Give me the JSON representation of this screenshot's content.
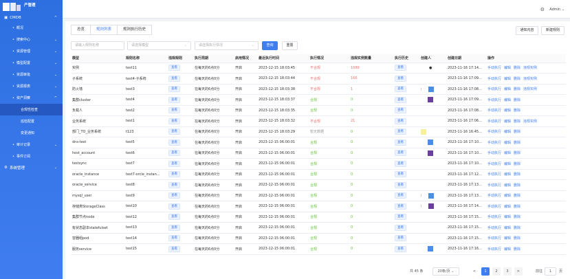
{
  "app": {
    "logo_text": "产管理"
  },
  "topbar": {
    "gear_icon": "gear-icon",
    "user": "Admin",
    "user_chevron": "⌄"
  },
  "sidebar": {
    "group": {
      "label": "CMDB",
      "icon": "grid-icon",
      "chevron": "^"
    },
    "items": [
      {
        "label": "概况",
        "has_children": false
      },
      {
        "label": "搜索中心",
        "has_children": true
      },
      {
        "label": "资源管理",
        "has_children": true
      },
      {
        "label": "模型配置",
        "has_children": true
      },
      {
        "label": "资源审批",
        "has_children": true
      },
      {
        "label": "资源报表",
        "has_children": true
      },
      {
        "label": "资产洞察",
        "has_children": true,
        "expanded": true
      }
    ],
    "sub_items": [
      {
        "label": "合规性检查",
        "active": true
      },
      {
        "label": "巡检配置",
        "active": false
      },
      {
        "label": "变更通知",
        "active": false
      }
    ],
    "items_after": [
      {
        "label": "审计记录",
        "has_children": true
      },
      {
        "label": "事件订阅",
        "has_children": false
      }
    ],
    "system": {
      "label": "系统管理",
      "icon": "settings-icon",
      "chevron": "⌄"
    }
  },
  "tabs": [
    {
      "label": "总览",
      "active": false
    },
    {
      "label": "规则列表",
      "active": true
    },
    {
      "label": "规则执行历史",
      "active": false
    }
  ],
  "toolbar": {
    "notify_label": "通知内容",
    "new_rule_label": "新建规则"
  },
  "filters": {
    "rule_name_placeholder": "请输入规则名称",
    "model_placeholder": "请选择模型",
    "exec_status_placeholder": "请选择执行情况",
    "search_label": "查询",
    "reset_label": "重置"
  },
  "table": {
    "headers": [
      "模型",
      "规则名称",
      "违规规则",
      "执行周期",
      "启用情况",
      "最近执行时间",
      "执行情况",
      "违规实例数量",
      "执行历史",
      "创建人",
      "创建日期",
      "操作"
    ],
    "view_label": "查看",
    "rows": [
      {
        "model": "实例",
        "name": "test11",
        "cycle": "在每天的6点0分",
        "enabled": "开启",
        "last": "2023-12-15 18:03:45",
        "status": "不合规",
        "status_type": "fail",
        "count": "1089",
        "count_type": "red",
        "creator": "",
        "avatar": "dot",
        "date": "2023-11-16 17:14...",
        "actions": [
          "手动执行",
          "编辑",
          "删除",
          "违规实例"
        ]
      },
      {
        "model": "子系统",
        "name": "test4-子系统",
        "cycle": "在每天的6点0分",
        "enabled": "开启",
        "last": "2023-12-15 18:03:44",
        "status": "不合规",
        "status_type": "fail",
        "count": "166",
        "count_type": "red",
        "creator": "",
        "avatar": "",
        "date": "2023-11-16 17:09...",
        "actions": [
          "手动执行",
          "编辑",
          "删除",
          "违规实例"
        ]
      },
      {
        "model": "防火墙",
        "name": "test3",
        "cycle": "在每天的6点0分",
        "enabled": "开启",
        "last": "2023-12-15 18:03:38",
        "status": "不合规",
        "status_type": "fail",
        "count": "1",
        "count_type": "red",
        "creator": "I",
        "avatar": "blue",
        "date": "2023-11-16 17:08...",
        "actions": [
          "手动执行",
          "编辑",
          "删除",
          "违规实例"
        ]
      },
      {
        "model": "集群cluster",
        "name": "test4",
        "cycle": "在每天的6点0分",
        "enabled": "开启",
        "last": "2023-12-15 18:03:37",
        "status": "合规",
        "status_type": "ok",
        "count": "0",
        "count_type": "green",
        "creator": "",
        "avatar": "purple",
        "date": "2023-11-16 17:09...",
        "actions": [
          "手动执行",
          "编辑",
          "删除"
        ]
      },
      {
        "model": "负载人",
        "name": "test2",
        "cycle": "在每天的6点0分",
        "enabled": "开启",
        "last": "2023-12-15 18:03:35",
        "status": "合规",
        "status_type": "ok",
        "count": "0",
        "count_type": "green",
        "creator": "",
        "avatar": "",
        "date": "2023-11-16 17:08...",
        "actions": [
          "手动执行",
          "编辑",
          "删除"
        ]
      },
      {
        "model": "业务系统",
        "name": "test1",
        "cycle": "在每天的6点0分",
        "enabled": "开启",
        "last": "2023-12-15 18:03:32",
        "status": "不合规",
        "status_type": "fail",
        "count": "21",
        "count_type": "red",
        "creator": "",
        "avatar": "",
        "date": "2023-11-16 17:06...",
        "actions": [
          "手动执行",
          "编辑",
          "删除",
          "违规实例"
        ]
      },
      {
        "model": "部门_TO_业务系统",
        "name": "t123",
        "cycle": "在每天的6点0分",
        "enabled": "开启",
        "last": "2023-12-15 18:03:29",
        "status": "暂无数据",
        "status_type": "none",
        "count": "0",
        "count_type": "green",
        "creator": "",
        "avatar": "yellow",
        "date": "2023-11-16 16:45...",
        "actions": [
          "手动执行",
          "编辑",
          "删除"
        ]
      },
      {
        "model": "dns-test",
        "name": "test5",
        "cycle": "在每天的6点0分",
        "enabled": "开启",
        "last": "2023-12-15 06:00:01",
        "status": "合规",
        "status_type": "ok",
        "count": "0",
        "count_type": "green",
        "creator": "",
        "avatar": "blue",
        "date": "2023-11-16 17:10...",
        "actions": [
          "手动执行",
          "编辑",
          "删除"
        ]
      },
      {
        "model": "host_account",
        "name": "test6",
        "cycle": "在每天的6点0分",
        "enabled": "开启",
        "last": "2023-12-15 06:00:01",
        "status": "合规",
        "status_type": "ok",
        "count": "0",
        "count_type": "green",
        "creator": "",
        "avatar": "purple",
        "date": "2023-11-16 17:10...",
        "actions": [
          "手动执行",
          "编辑",
          "删除"
        ]
      },
      {
        "model": "testsync",
        "name": "test7",
        "cycle": "在每天的6点0分",
        "enabled": "开启",
        "last": "2023-12-15 06:00:01",
        "status": "合规",
        "status_type": "ok",
        "count": "0",
        "count_type": "green",
        "creator": "",
        "avatar": "",
        "date": "2023-11-16 17:10...",
        "actions": [
          "手动执行",
          "编辑",
          "删除"
        ]
      },
      {
        "model": "oracle_instance",
        "name": "test7-orcle_instan...",
        "cycle": "在每天的6点0分",
        "enabled": "开启",
        "last": "2023-12-15 06:00:01",
        "status": "合规",
        "status_type": "ok",
        "count": "0",
        "count_type": "green",
        "creator": "",
        "avatar": "",
        "date": "2023-11-16 17:12...",
        "actions": [
          "手动执行",
          "编辑",
          "删除"
        ]
      },
      {
        "model": "oracle_service",
        "name": "test8",
        "cycle": "在每天的6点0分",
        "enabled": "开启",
        "last": "2023-12-15 06:00:01",
        "status": "合规",
        "status_type": "ok",
        "count": "0",
        "count_type": "green",
        "creator": "",
        "avatar": "",
        "date": "2023-11-16 17:13...",
        "actions": [
          "手动执行",
          "编辑",
          "删除"
        ]
      },
      {
        "model": "mysql_user",
        "name": "test9",
        "cycle": "在每天的6点0分",
        "enabled": "开启",
        "last": "2023-12-15 06:00:01",
        "status": "合规",
        "status_type": "ok",
        "count": "0",
        "count_type": "green",
        "creator": "I",
        "avatar": "blue",
        "date": "2023-11-16 17:13...",
        "actions": [
          "手动执行",
          "编辑",
          "删除"
        ]
      },
      {
        "model": "存储类StorageClass",
        "name": "test10",
        "cycle": "在每天的6点0分",
        "enabled": "开启",
        "last": "2023-12-15 06:00:01",
        "status": "合规",
        "status_type": "ok",
        "count": "0",
        "count_type": "green",
        "creator": "I",
        "avatar": "purple",
        "date": "2023-11-16 17:14...",
        "actions": [
          "手动执行",
          "编辑",
          "删除"
        ]
      },
      {
        "model": "集群节点node",
        "name": "test12",
        "cycle": "在每天的6点0分",
        "enabled": "开启",
        "last": "2023-12-15 06:00:01",
        "status": "合规",
        "status_type": "ok",
        "count": "0",
        "count_type": "green",
        "creator": "",
        "avatar": "",
        "date": "2023-11-16 17:15...",
        "actions": [
          "手动执行",
          "编辑",
          "删除"
        ]
      },
      {
        "model": "有状态副本statefulset",
        "name": "test13",
        "cycle": "在每天的6点0分",
        "enabled": "开启",
        "last": "2023-12-15 06:00:01",
        "status": "合规",
        "status_type": "ok",
        "count": "0",
        "count_type": "green",
        "creator": "",
        "avatar": "",
        "date": "2023-11-16 17:15...",
        "actions": [
          "手动执行",
          "编辑",
          "删除"
        ]
      },
      {
        "model": "容器组pod",
        "name": "test14",
        "cycle": "在每天的6点0分",
        "enabled": "开启",
        "last": "2023-12-15 06:00:01",
        "status": "合规",
        "status_type": "ok",
        "count": "0",
        "count_type": "green",
        "creator": "",
        "avatar": "",
        "date": "2023-11-16 17:15...",
        "actions": [
          "手动执行",
          "编辑",
          "删除"
        ]
      },
      {
        "model": "服务service",
        "name": "test15",
        "cycle": "在每天的6点0分",
        "enabled": "开启",
        "last": "2023-12-15 06:00:01",
        "status": "合规",
        "status_type": "ok",
        "count": "0",
        "count_type": "green",
        "creator": "",
        "avatar": "blue",
        "date": "2023-11-16 17:16...",
        "actions": [
          "手动执行",
          "编辑",
          "删除"
        ]
      }
    ]
  },
  "pagination": {
    "total": "共 45 条",
    "page_size": "20条/页",
    "prev": "<",
    "pages": [
      "1",
      "2",
      "3"
    ],
    "current": "1",
    "next": ">",
    "goto_label": "前往",
    "goto_value": "1",
    "page_unit": "页"
  },
  "colors": {
    "primary": "#3f7df0",
    "sidebar": "#2d6fe0",
    "fail": "#f56c6c",
    "ok": "#67c23a",
    "avatar_blue": "#4a8ee6",
    "avatar_purple": "#6b3fa0",
    "avatar_yellow": "#f7f19a"
  }
}
